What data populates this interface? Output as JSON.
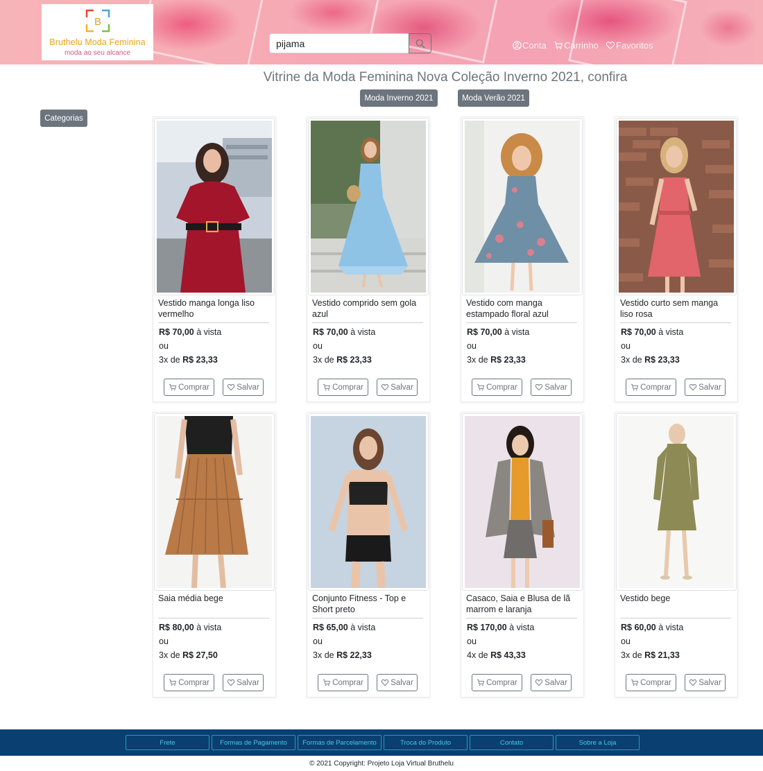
{
  "brand": {
    "logo_letter": "B",
    "name": "Bruthelu Moda Feminina",
    "tagline": "moda ao seu alcance"
  },
  "search": {
    "value": "pijama"
  },
  "nav": {
    "account": "Conta",
    "cart": "Carrinho",
    "favorites": "Favoritos"
  },
  "page_title": "Vitrine da Moda Feminina Nova Coleção Inverno 2021, confira",
  "filters": {
    "winter": "Moda Inverno 2021",
    "summer": "Moda Verão 2021"
  },
  "categories_label": "Categorias",
  "labels": {
    "cash_suffix": "à vista",
    "or": "ou",
    "of": "de",
    "buy": "Comprar",
    "save": "Salvar"
  },
  "products": [
    {
      "name": "Vestido manga longa liso vermelho",
      "price": "R$ 70,00",
      "installments": "3x",
      "installment_value": "R$ 23,33"
    },
    {
      "name": "Vestido comprido sem gola azul",
      "price": "R$ 70,00",
      "installments": "3x",
      "installment_value": "R$ 23,33"
    },
    {
      "name": "Vestido com manga estampado floral azul",
      "price": "R$ 70,00",
      "installments": "3x",
      "installment_value": "R$ 23,33"
    },
    {
      "name": "Vestido curto sem manga liso rosa",
      "price": "R$ 70,00",
      "installments": "3x",
      "installment_value": "R$ 23,33"
    },
    {
      "name": "Saia média bege",
      "price": "R$ 80,00",
      "installments": "3x",
      "installment_value": "R$ 27,50"
    },
    {
      "name": "Conjunto Fitness - Top e Short preto",
      "price": "R$ 65,00",
      "installments": "3x",
      "installment_value": "R$ 22,33"
    },
    {
      "name": "Casaco, Saia e Blusa de lã marrom e laranja",
      "price": "R$ 170,00",
      "installments": "4x",
      "installment_value": "R$ 43,33"
    },
    {
      "name": "Vestido bege",
      "price": "R$ 60,00",
      "installments": "3x",
      "installment_value": "R$ 21,33"
    }
  ],
  "footer": {
    "links": [
      "Frete",
      "Formas de Pagamento",
      "Formas de Parcelamento",
      "Troca do Produto",
      "Contato",
      "Sobre a Loja"
    ],
    "copyright": "© 2021 Copyright: Projeto Loja Virtual Bruthelu"
  },
  "colors": {
    "header_pink": "#f6a9b4",
    "button_gray": "#6c757d",
    "footer_navy": "#0a3f72",
    "footer_link": "#17a2b8",
    "brand_orange": "#e8a21f"
  }
}
